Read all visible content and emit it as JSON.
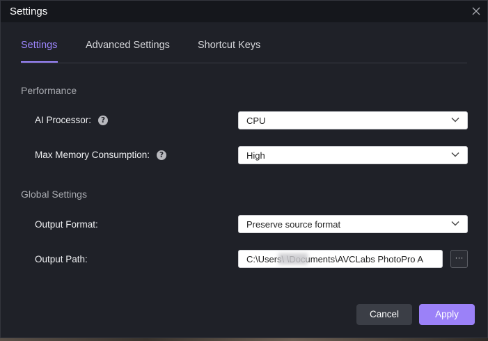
{
  "window": {
    "title": "Settings"
  },
  "tabs": [
    {
      "label": "Settings",
      "active": true
    },
    {
      "label": "Advanced Settings",
      "active": false
    },
    {
      "label": "Shortcut Keys",
      "active": false
    }
  ],
  "performance": {
    "section_title": "Performance",
    "ai_processor": {
      "label": "AI Processor:",
      "value": "CPU"
    },
    "max_memory": {
      "label": "Max Memory Consumption:",
      "value": "High"
    }
  },
  "global": {
    "section_title": "Global Settings",
    "output_format": {
      "label": "Output Format:",
      "value": "Preserve source format"
    },
    "output_path": {
      "label": "Output Path:",
      "value": "C:\\Users\\ \\Documents\\AVCLabs PhotoPro A"
    }
  },
  "buttons": {
    "browse": "···",
    "cancel": "Cancel",
    "apply": "Apply"
  },
  "icons": {
    "help": "?"
  },
  "colors": {
    "accent": "#9d86ff",
    "apply": "#9b81f8",
    "background": "#1f2128"
  }
}
